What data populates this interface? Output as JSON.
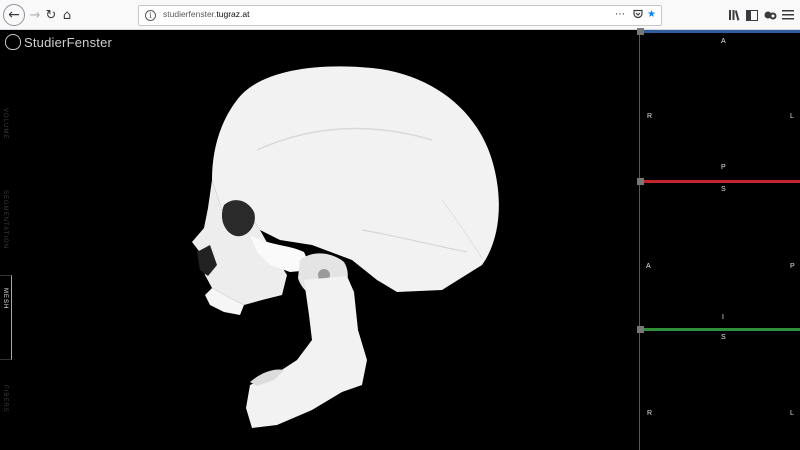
{
  "browser": {
    "url_prefix": "studierfenster.",
    "url_domain": "tugraz.at",
    "more_icon": "⋯",
    "pocket_icon": "pocket-icon",
    "star_icon": "star-icon"
  },
  "app": {
    "logo_text": "StudierFenster",
    "tabs": [
      {
        "label": "VOLUME",
        "active": false
      },
      {
        "label": "SEGMENTATION",
        "active": false
      },
      {
        "label": "MESH",
        "active": true
      },
      {
        "label": "FIBERS",
        "active": false
      }
    ]
  },
  "slices": {
    "axial": {
      "top": "A",
      "left": "R",
      "right": "L",
      "bottom": "P",
      "color": "#2f5f9e"
    },
    "sagittal": {
      "top": "S",
      "left": "A",
      "right": "P",
      "bottom": "I",
      "color": "#c0262c"
    },
    "coronal": {
      "top": "S",
      "left": "R",
      "right": "L",
      "color": "#2f8f3a"
    }
  }
}
